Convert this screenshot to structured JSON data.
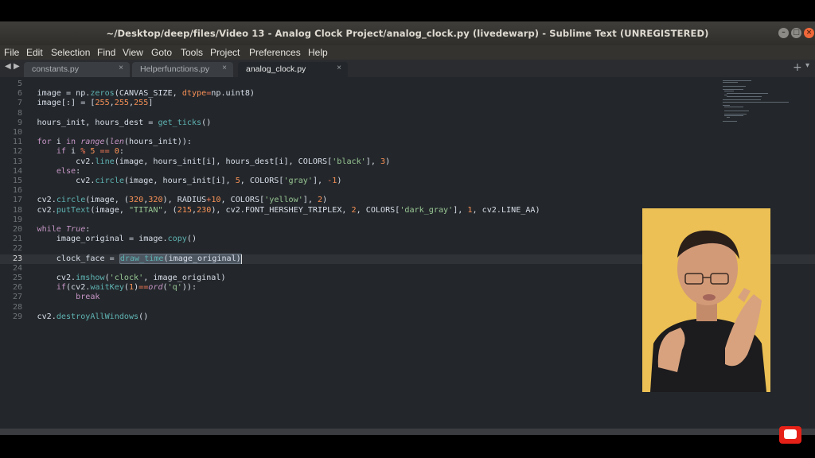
{
  "window": {
    "title": "~/Desktop/deep/files/Video 13 - Analog Clock  Project/analog_clock.py (livedewarp) - Sublime Text (UNREGISTERED)"
  },
  "menu": [
    "File",
    "Edit",
    "Selection",
    "Find",
    "View",
    "Goto",
    "Tools",
    "Project",
    "Preferences",
    "Help"
  ],
  "tabs": [
    {
      "label": "constants.py",
      "active": false
    },
    {
      "label": "Helperfunctions.py",
      "active": false
    },
    {
      "label": "analog_clock.py",
      "active": true
    }
  ],
  "editor": {
    "current_line": 23,
    "lines": [
      {
        "n": 5,
        "t": ""
      },
      {
        "n": 6,
        "t": "image = np.zeros(CANVAS_SIZE, dtype=np.uint8)"
      },
      {
        "n": 7,
        "t": "image[:] = [255,255,255]"
      },
      {
        "n": 8,
        "t": ""
      },
      {
        "n": 9,
        "t": "hours_init, hours_dest = get_ticks()"
      },
      {
        "n": 10,
        "t": ""
      },
      {
        "n": 11,
        "t": "for i in range(len(hours_init)):"
      },
      {
        "n": 12,
        "t": "    if i % 5 == 0:"
      },
      {
        "n": 13,
        "t": "        cv2.line(image, hours_init[i], hours_dest[i], COLORS['black'], 3)"
      },
      {
        "n": 14,
        "t": "    else:"
      },
      {
        "n": 15,
        "t": "        cv2.circle(image, hours_init[i], 5, COLORS['gray'], -1)"
      },
      {
        "n": 16,
        "t": ""
      },
      {
        "n": 17,
        "t": "cv2.circle(image, (320,320), RADIUS+10, COLORS['yellow'], 2)"
      },
      {
        "n": 18,
        "t": "cv2.putText(image, \"TITAN\", (215,230), cv2.FONT_HERSHEY_TRIPLEX, 2, COLORS['dark_gray'], 1, cv2.LINE_AA)"
      },
      {
        "n": 19,
        "t": ""
      },
      {
        "n": 20,
        "t": "while True:"
      },
      {
        "n": 21,
        "t": "    image_original = image.copy()"
      },
      {
        "n": 22,
        "t": ""
      },
      {
        "n": 23,
        "t": "    clock_face = draw_time(image_original)"
      },
      {
        "n": 24,
        "t": ""
      },
      {
        "n": 25,
        "t": "    cv2.imshow('clock', image_original)"
      },
      {
        "n": 26,
        "t": "    if(cv2.waitKey(1)==ord('q')):"
      },
      {
        "n": 27,
        "t": "        break"
      },
      {
        "n": 28,
        "t": ""
      },
      {
        "n": 29,
        "t": "cv2.destroyAllWindows()"
      }
    ]
  },
  "icons": {
    "tab_close": "close-icon",
    "new_tab": "plus-icon",
    "tab_menu": "chevron-down-icon",
    "nav_prev": "caret-left-icon",
    "nav_next": "caret-right-icon",
    "youtube": "youtube-icon"
  },
  "colors": {
    "editor_bg": "#23272b",
    "current_line": "#2f3337",
    "function": "#5fb3b3",
    "keyword": "#c594c5",
    "string": "#99c794",
    "number": "#f99157",
    "close_button": "#f0683a",
    "youtube_red": "#e62117"
  }
}
